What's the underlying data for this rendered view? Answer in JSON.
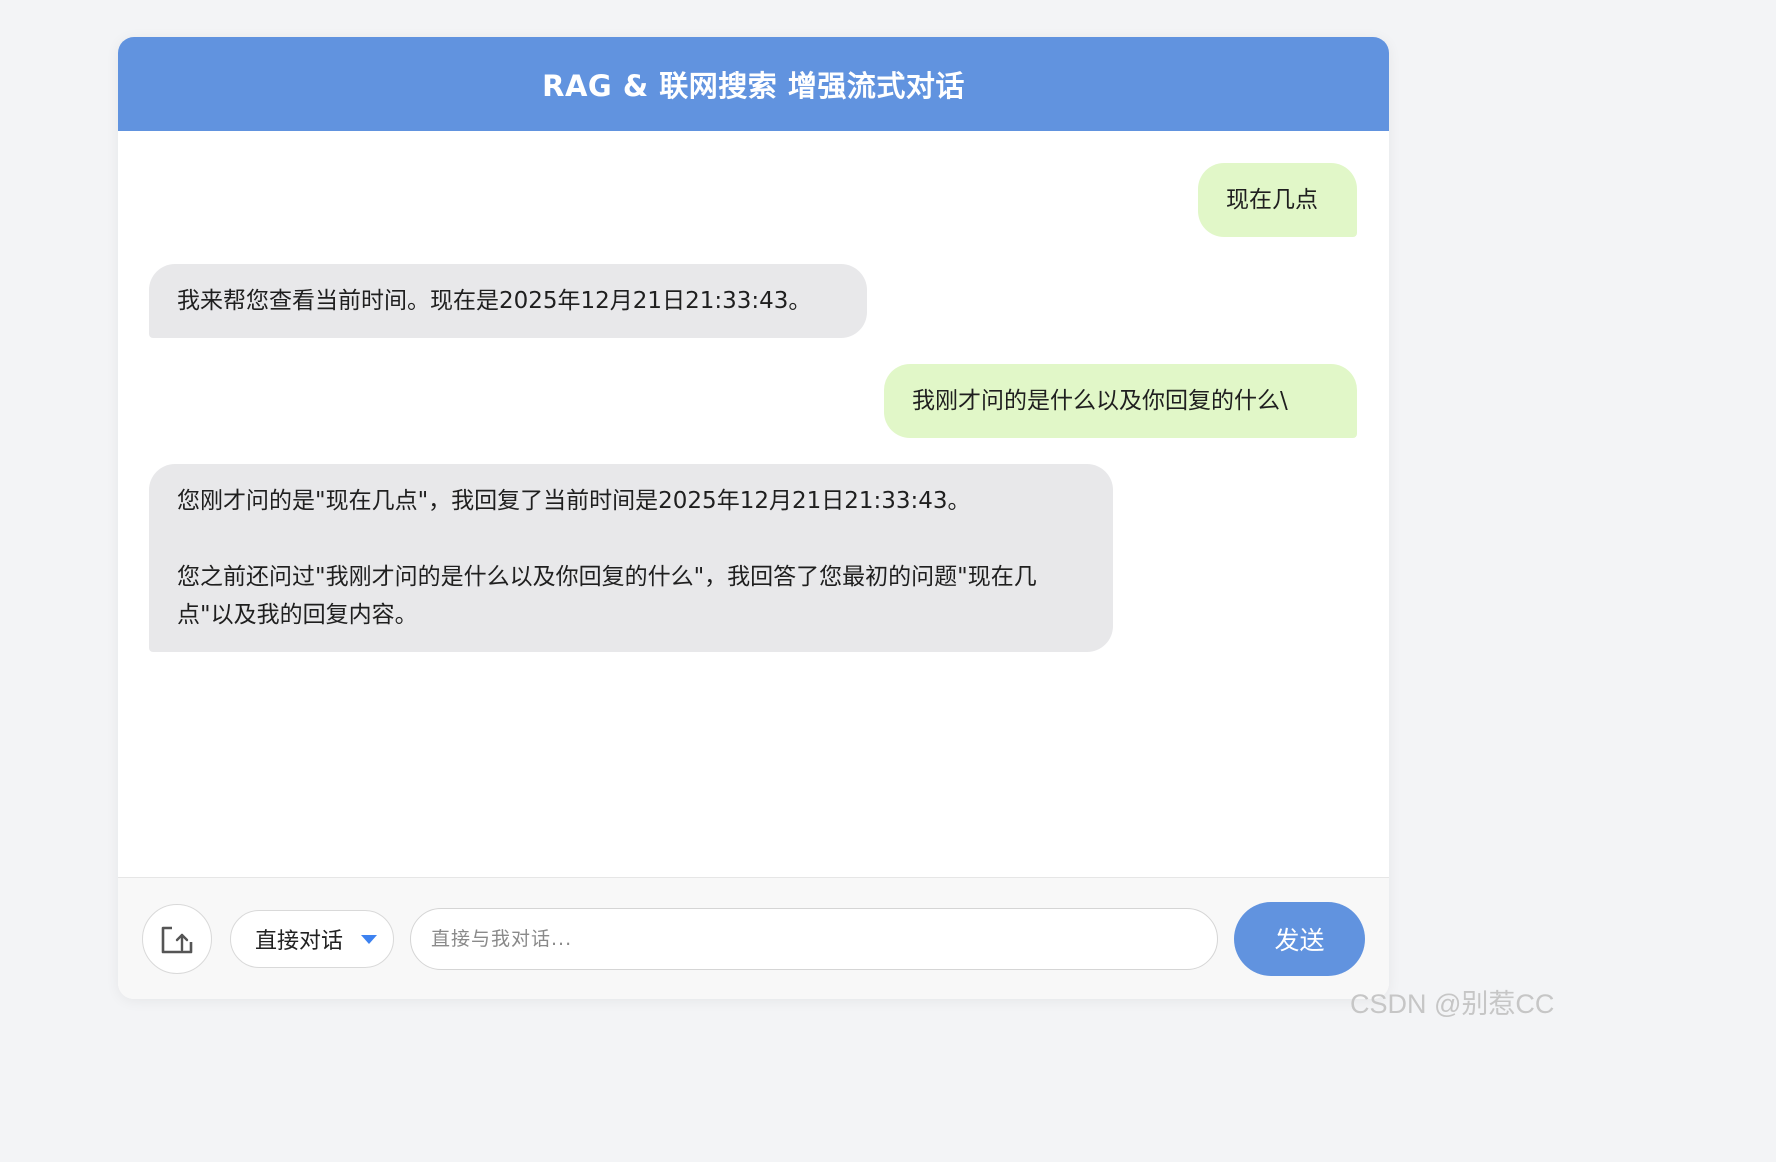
{
  "header": {
    "title": "RAG & 联网搜索 增强流式对话"
  },
  "messages": [
    {
      "role": "user",
      "text": "现在几点"
    },
    {
      "role": "bot",
      "text": "我来帮您查看当前时间。现在是2025年12月21日21:33:43。"
    },
    {
      "role": "user",
      "text": "我刚才问的是什么以及你回复的什么\\"
    },
    {
      "role": "bot",
      "paragraph_1": "您刚才问的是\"现在几点\"，我回复了当前时间是2025年12月21日21:33:43。",
      "paragraph_2": "您之前还问过\"我刚才问的是什么以及你回复的什么\"，我回答了您最初的问题\"现在几点\"以及我的回复内容。"
    }
  ],
  "input_bar": {
    "upload_icon": "upload-icon",
    "mode_select": {
      "selected": "直接对话",
      "caret_icon": "chevron-down-icon",
      "accent_color": "#3d82f0"
    },
    "input_placeholder": "直接与我对话...",
    "input_value": "",
    "send_label": "发送"
  },
  "colors": {
    "primary": "#6193df",
    "user_bubble": "#e1f7c8",
    "bot_bubble": "#e8e8ea",
    "page_background": "#f3f4f6"
  },
  "watermark": "CSDN @别惹CC"
}
